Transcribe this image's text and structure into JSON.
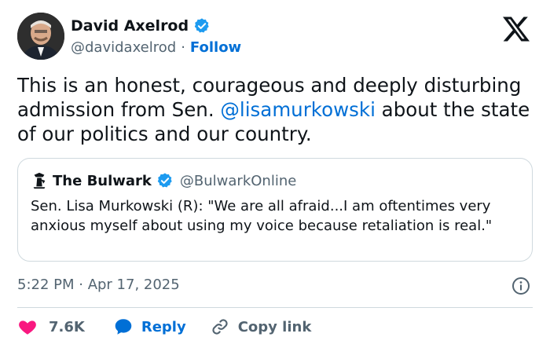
{
  "author": {
    "display_name": "David Axelrod",
    "handle": "@davidaxelrod",
    "separator": "·",
    "follow_label": "Follow",
    "verified": true
  },
  "tweet": {
    "text_before": "This is an honest, courageous and deeply disturbing admission from Sen.  ",
    "mention": "@lisamurkowski",
    "text_after": " about the state of our politics and our country."
  },
  "quote": {
    "display_name": "The Bulwark",
    "handle": "@BulwarkOnline",
    "text": "Sen. Lisa Murkowski (R): \"We are all afraid...I am oftentimes very anxious myself about using my voice because retaliation is real.\""
  },
  "timestamp": "5:22 PM · Apr 17, 2025",
  "actions": {
    "likes": "7.6K",
    "reply_label": "Reply",
    "copy_label": "Copy link"
  },
  "colors": {
    "link": "#006fd6",
    "like": "#f91880",
    "secondary_text": "#536471",
    "border": "#cfd9de",
    "verified": "#1d9bf0"
  },
  "icons": [
    "verified-badge-icon",
    "x-logo-icon",
    "bulwark-logo-icon",
    "info-icon",
    "heart-icon",
    "reply-bubble-icon",
    "link-icon"
  ]
}
